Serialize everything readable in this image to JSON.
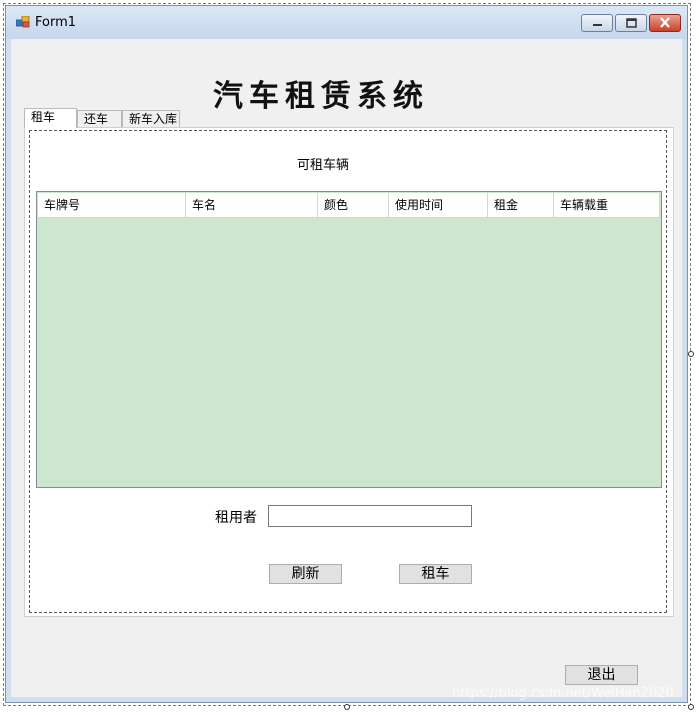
{
  "window": {
    "title": "Form1"
  },
  "app_title": "汽车租赁系统",
  "tabs": [
    {
      "label": "租车",
      "selected": true
    },
    {
      "label": "还车",
      "selected": false
    },
    {
      "label": "新车入库",
      "selected": false
    }
  ],
  "grid": {
    "caption": "可租车辆",
    "columns": [
      "车牌号",
      "车名",
      "颜色",
      "使用时间",
      "租金",
      "车辆载重"
    ],
    "rows": []
  },
  "form": {
    "renter_label": "租用者",
    "renter_value": ""
  },
  "buttons": {
    "refresh": "刷新",
    "rent": "租车",
    "exit": "退出"
  },
  "watermark": "https://blog.csdn.net/WeiHan2020",
  "colors": {
    "grid_background": "#cce6cf",
    "form_background": "#f0f0f0",
    "title_bar": "#c5d7ec",
    "close_button": "#c8402a"
  }
}
